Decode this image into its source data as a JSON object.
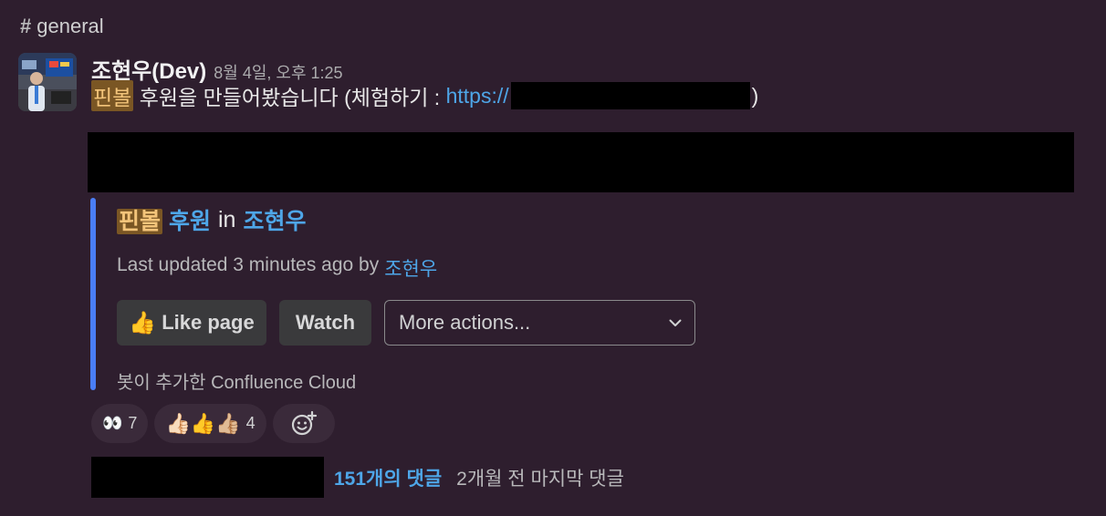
{
  "channel": {
    "hash": "#",
    "name": "general"
  },
  "message": {
    "author": "조현우(Dev)",
    "timestamp": "8월 4일, 오후 1:25",
    "highlight": "핀볼",
    "text_before_link": " 후원을 만들어봤습니다 (체험하기 : ",
    "link_text": "https://",
    "text_after_link": ")"
  },
  "attachment": {
    "title_highlight": "핀볼",
    "title_rest": "후원",
    "title_in": "in",
    "space_name": "조현우",
    "updated_prefix": "Last updated 3 minutes ago by",
    "updated_by": "조현우",
    "like_label": "Like page",
    "like_emoji": "👍",
    "watch_label": "Watch",
    "more_actions_placeholder": "More actions...",
    "footer": "봇이 추가한 Confluence Cloud"
  },
  "reactions": [
    {
      "emoji": "👀",
      "count": "7"
    },
    {
      "emoji": "👍🏻👍👍🏼",
      "count": "4"
    }
  ],
  "thread": {
    "reply_count": "151개의 댓글",
    "last_reply": "2개월 전 마지막 댓글"
  },
  "colors": {
    "background": "#2e1e2e",
    "link": "#4ea6e8",
    "highlight_bg": "#7a5624",
    "attachment_bar": "#4a7ef5"
  }
}
